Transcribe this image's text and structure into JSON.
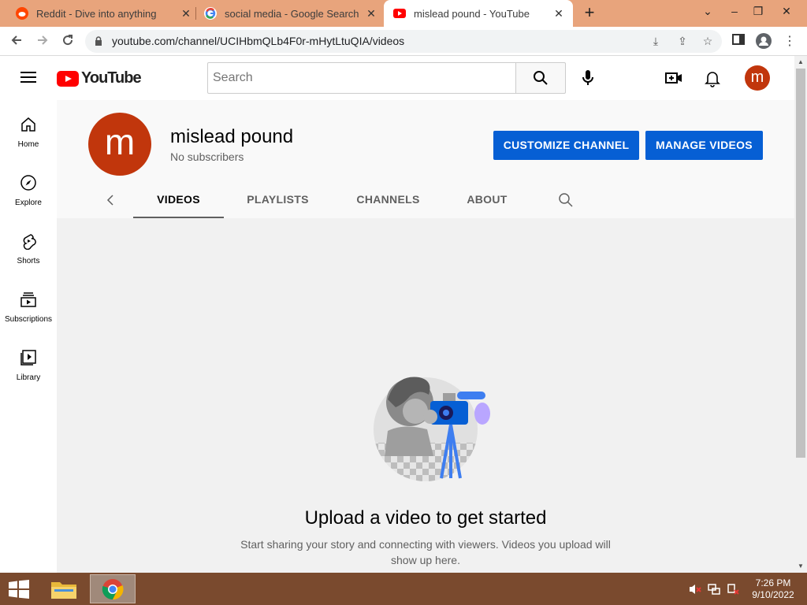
{
  "browser": {
    "tabs": [
      {
        "title": "Reddit - Dive into anything",
        "favicon": "reddit-icon",
        "active": false
      },
      {
        "title": "social media - Google Search",
        "favicon": "google-icon",
        "active": false
      },
      {
        "title": "mislead pound - YouTube",
        "favicon": "youtube-icon",
        "active": true
      }
    ],
    "url": "youtube.com/channel/UCIHbmQLb4F0r-mHytLtuQIA/videos"
  },
  "masthead": {
    "logo_text": "YouTube",
    "search_placeholder": "Search",
    "avatar_letter": "m"
  },
  "guide": {
    "items": [
      {
        "label": "Home",
        "icon": "home-icon"
      },
      {
        "label": "Explore",
        "icon": "compass-icon"
      },
      {
        "label": "Shorts",
        "icon": "shorts-icon"
      },
      {
        "label": "Subscriptions",
        "icon": "subscriptions-icon"
      },
      {
        "label": "Library",
        "icon": "library-icon"
      }
    ]
  },
  "channel": {
    "avatar_letter": "m",
    "name": "mislead pound",
    "subscribers": "No subscribers",
    "customize_label": "CUSTOMIZE CHANNEL",
    "manage_label": "MANAGE VIDEOS",
    "tabs": [
      "VIDEOS",
      "PLAYLISTS",
      "CHANNELS",
      "ABOUT"
    ],
    "active_tab": "VIDEOS"
  },
  "empty_state": {
    "title": "Upload a video to get started",
    "description": "Start sharing your story and connecting with viewers. Videos you upload will show up here."
  },
  "taskbar": {
    "time": "7:26 PM",
    "date": "9/10/2022"
  },
  "colors": {
    "tab_strip": "#e8a47c",
    "youtube_red": "#ff0000",
    "avatar": "#c1360c",
    "primary_button": "#065fd4",
    "taskbar": "#7a4a2e"
  }
}
